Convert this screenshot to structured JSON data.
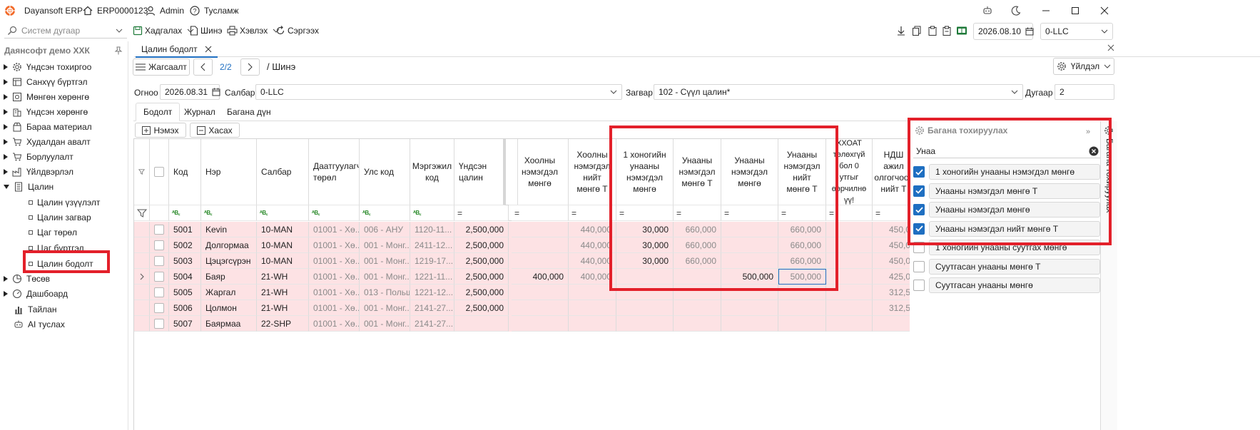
{
  "app": {
    "name": "Dayansoft ERP",
    "doc_number": "ERP0000123",
    "user": "Admin",
    "help": "Тусламж"
  },
  "toolbar": {
    "search_placeholder": "Систем дугаар",
    "print_label": "Хадгалах",
    "new_label": "Шинэ",
    "export_label": "Хэвлэх",
    "refresh_label": "Сэргээх",
    "date": "2026.08.10",
    "branch": "0-LLC"
  },
  "sidebar": {
    "company": "Даянсофт демо ХХК",
    "items": [
      {
        "label": "Үндсэн тохиргоо"
      },
      {
        "label": "Санхүү бүртгэл"
      },
      {
        "label": "Мөнгөн хөрөнгө"
      },
      {
        "label": "Үндсэн хөрөнгө"
      },
      {
        "label": "Бараа материал"
      },
      {
        "label": "Худалдан авалт"
      },
      {
        "label": "Борлуулалт"
      },
      {
        "label": "Үйлдвэрлэл"
      },
      {
        "label": "Цалин"
      },
      {
        "label": "Цалин үзүүлэлт"
      },
      {
        "label": "Цалин загвар"
      },
      {
        "label": "Цаг төрөл"
      },
      {
        "label": "Цаг бүртгэл"
      },
      {
        "label": "Цалин бодолт"
      },
      {
        "label": "Төсөв"
      },
      {
        "label": "Дашбоард"
      },
      {
        "label": "Тайлан"
      },
      {
        "label": "AI туслах"
      }
    ]
  },
  "document": {
    "tab_label": "Цалин бодолт",
    "list_button": "Жагсаалт",
    "pager": "2/2",
    "breadcrumb": "/ Шинэ",
    "actions_button": "Үйлдэл",
    "date_label": "Огноо",
    "date_value": "2026.08.31",
    "branch_label": "Салбар",
    "branch_value": "0-LLC",
    "template_label": "Загвар",
    "template_value": "102 - Сүүл цалин*",
    "number_label": "Дугаар",
    "number_value": "2",
    "subtabs": [
      "Бодолт",
      "Журнал",
      "Багана дүн"
    ],
    "add_button": "Нэмэх",
    "remove_button": "Хасах"
  },
  "grid": {
    "headers": {
      "code": "Код",
      "name": "Нэр",
      "branch": "Салбар",
      "insurer_type": "Даатгуулагч төрөл",
      "country": "Улс код",
      "profession": "Мэргэжил код",
      "base_salary": "Үндсэн цалин",
      "meal_allow": "Хоолны нэмэгдэл мөнгө",
      "meal_total": "Хоолны нэмэгдэл нийт мөнгө Т",
      "daily_car": "1 хоногийн унааны нэмэгдэл мөнгө",
      "car_t": "Унааны нэмэгдэл мөнгө Т",
      "car": "Унааны нэмэгдэл мөнгө",
      "car_total": "Унааны нэмэгдэл нийт мөнгө Т",
      "pit": "ХХОАТ төлөхгүй бол 0 утгыг өөрчилнө үү!",
      "vat": "НДШ ажил олгогчоос нийт Т"
    },
    "rows": [
      {
        "code": "5001",
        "name": "Kevin",
        "branch": "10-MAN",
        "insurer": "01001 - Хө...",
        "country": "006 - АНУ",
        "prof": "1120-11...",
        "base": "2,500,000",
        "meal": "",
        "meal_t": "440,000",
        "daily": "30,000",
        "car_t": "660,000",
        "car": "",
        "car_total": "660,000",
        "pit": "",
        "vat": "450,0"
      },
      {
        "code": "5002",
        "name": "Долгормаа",
        "branch": "10-MAN",
        "insurer": "01001 - Хө...",
        "country": "001 - Монг...",
        "prof": "2411-12...",
        "base": "2,500,000",
        "meal": "",
        "meal_t": "440,000",
        "daily": "30,000",
        "car_t": "660,000",
        "car": "",
        "car_total": "660,000",
        "pit": "",
        "vat": "450,0"
      },
      {
        "code": "5003",
        "name": "Цэцэгсүрэн",
        "branch": "10-MAN",
        "insurer": "01001 - Хө...",
        "country": "001 - Монг...",
        "prof": "1219-17...",
        "base": "2,500,000",
        "meal": "",
        "meal_t": "440,000",
        "daily": "30,000",
        "car_t": "660,000",
        "car": "",
        "car_total": "660,000",
        "pit": "",
        "vat": "450,0"
      },
      {
        "code": "5004",
        "name": "Баяр",
        "branch": "21-WH",
        "insurer": "01001 - Хө...",
        "country": "001 - Монг...",
        "prof": "1221-11...",
        "base": "2,500,000",
        "meal": "400,000",
        "meal_t": "400,000",
        "daily": "",
        "car_t": "",
        "car": "500,000",
        "car_total": "500,000",
        "pit": "",
        "vat": "425,0"
      },
      {
        "code": "5005",
        "name": "Жаргал",
        "branch": "21-WH",
        "insurer": "01001 - Хө...",
        "country": "013 - Польш",
        "prof": "1221-12...",
        "base": "2,500,000",
        "meal": "",
        "meal_t": "",
        "daily": "",
        "car_t": "",
        "car": "",
        "car_total": "",
        "pit": "",
        "vat": "312,5"
      },
      {
        "code": "5006",
        "name": "Цолмон",
        "branch": "21-WH",
        "insurer": "01001 - Хө...",
        "country": "001 - Монг...",
        "prof": "2141-27...",
        "base": "2,500,000",
        "meal": "",
        "meal_t": "",
        "daily": "",
        "car_t": "",
        "car": "",
        "car_total": "",
        "pit": "",
        "vat": "312,5"
      },
      {
        "code": "5007",
        "name": "Баярмаа",
        "branch": "22-SHP",
        "insurer": "01001 - Хө...",
        "country": "001 - Монг...",
        "prof": "2141-27...",
        "base": "",
        "meal": "",
        "meal_t": "",
        "daily": "",
        "car_t": "",
        "car": "",
        "car_total": "",
        "pit": "",
        "vat": ""
      }
    ]
  },
  "column_chooser": {
    "title": "Багана тохируулах",
    "side_tab": "Багана тохируулах",
    "search_value": "Унаа",
    "items": [
      {
        "label": "1 хоногийн унааны нэмэгдэл мөнгө",
        "checked": true
      },
      {
        "label": "Унааны нэмэгдэл мөнгө Т",
        "checked": true
      },
      {
        "label": "Унааны нэмэгдэл мөнгө",
        "checked": true
      },
      {
        "label": "Унааны нэмэгдэл нийт мөнгө Т",
        "checked": true
      },
      {
        "label": "1 хоногийн унааны суутгах мөнгө",
        "checked": false
      },
      {
        "label": "Суутгасан унааны мөнгө Т",
        "checked": false
      },
      {
        "label": "Суутгасан унааны мөнгө",
        "checked": false
      }
    ]
  },
  "colors": {
    "highlight_red": "#e3202a",
    "row_pink": "#fde2e4",
    "accent_blue": "#1f6fc1",
    "logo_orange": "#f26b2a"
  }
}
